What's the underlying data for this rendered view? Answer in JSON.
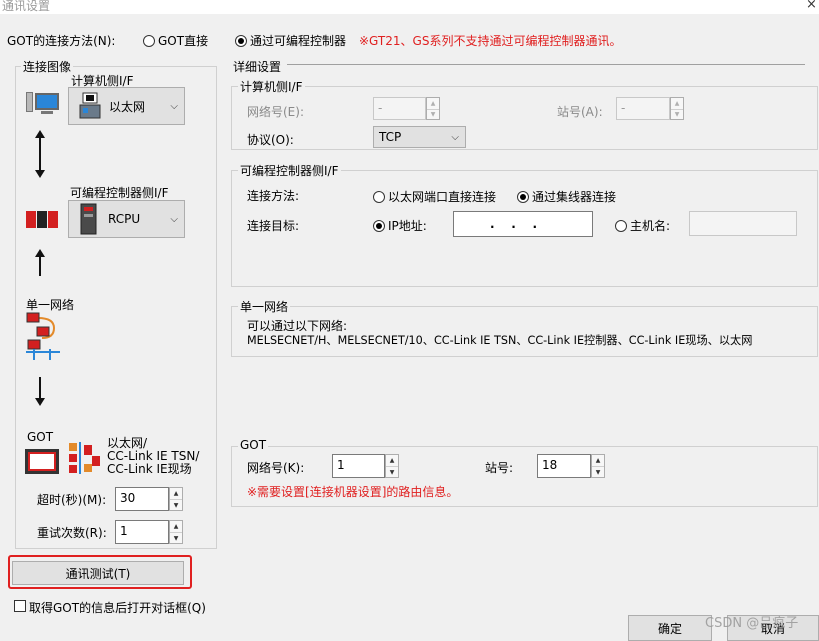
{
  "window": {
    "title": "通讯设置",
    "close_icon": "×"
  },
  "connection": {
    "label": "GOT的连接方法(N):",
    "option_direct": "GOT直接",
    "option_plc": "通过可编程控制器",
    "selected": "option_plc",
    "warning": "※GT21、GS系列不支持通过可编程控制器通讯。"
  },
  "image_panel": {
    "title": "连接图像",
    "pc_if_label": "计算机侧I/F",
    "pc_if_value": "以太网",
    "plc_if_label": "可编程控制器侧I/F",
    "plc_if_value": "RCPU",
    "single_network": "单一网络",
    "got_label": "GOT",
    "got_network_lines": [
      "以太网/",
      "CC-Link IE TSN/",
      "CC-Link IE现场"
    ],
    "timeout_label": "超时(秒)(M):",
    "timeout_value": "30",
    "retry_label": "重试次数(R):",
    "retry_value": "1"
  },
  "detail": {
    "title": "详细设置",
    "pc_side": {
      "title": "计算机侧I/F",
      "network_no_label": "网络号(E):",
      "network_no_value": "-",
      "station_label": "站号(A):",
      "station_value": "-",
      "protocol_label": "协议(O):",
      "protocol_value": "TCP"
    },
    "plc_side": {
      "title": "可编程控制器侧I/F",
      "method_label": "连接方法:",
      "method_direct": "以太网端口直接连接",
      "method_hub": "通过集线器连接",
      "method_selected": "hub",
      "target_label": "连接目标:",
      "target_ip": "IP地址:",
      "ip_value": ".    .    .",
      "target_host": "主机名:",
      "target_selected": "ip"
    },
    "single_network": {
      "title": "单一网络",
      "line1": "可以通过以下网络:",
      "line2": "MELSECNET/H、MELSECNET/10、CC-Link IE TSN、CC-Link IE控制器、CC-Link IE现场、以太网"
    },
    "got": {
      "title": "GOT",
      "network_no_label": "网络号(K):",
      "network_no_value": "1",
      "station_label": "站号:",
      "station_value": "18",
      "note": "※需要设置[连接机器设置]的路由信息。"
    }
  },
  "comm_test_button": "通讯测试(T)",
  "open_dialog_checkbox": "取得GOT的信息后打开对话框(Q)",
  "ok_button": "确定",
  "cancel_button": "取消",
  "watermark": "CSDN @吕疯子",
  "colors": {
    "highlight_red": "#e02020",
    "accent_blue": "#2a86d8"
  }
}
